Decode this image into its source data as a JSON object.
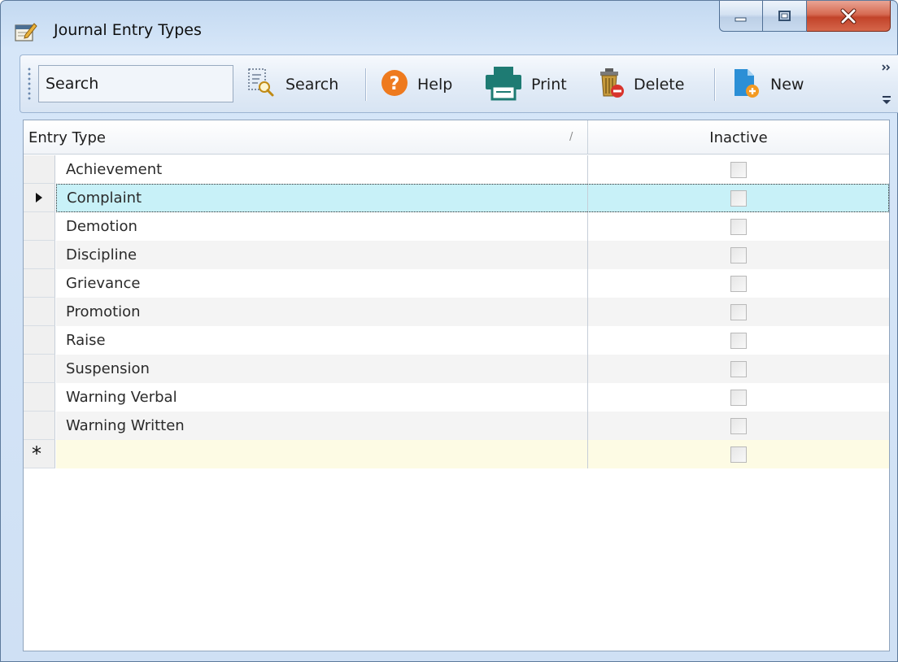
{
  "window": {
    "title": "Journal Entry Types"
  },
  "toolbar": {
    "search_placeholder": "Search",
    "search_label": "Search",
    "help_label": "Help",
    "print_label": "Print",
    "delete_label": "Delete",
    "new_label": "New"
  },
  "grid": {
    "columns": [
      "Entry Type",
      "Inactive"
    ],
    "rows": [
      {
        "entry_type": "Achievement",
        "inactive": false
      },
      {
        "entry_type": "Complaint",
        "inactive": false,
        "selected": true
      },
      {
        "entry_type": "Demotion",
        "inactive": false
      },
      {
        "entry_type": "Discipline",
        "inactive": false
      },
      {
        "entry_type": "Grievance",
        "inactive": false
      },
      {
        "entry_type": "Promotion",
        "inactive": false
      },
      {
        "entry_type": "Raise",
        "inactive": false
      },
      {
        "entry_type": "Suspension",
        "inactive": false
      },
      {
        "entry_type": "Warning Verbal",
        "inactive": false
      },
      {
        "entry_type": "Warning Written",
        "inactive": false
      }
    ],
    "new_row_glyph": "*"
  },
  "colors": {
    "selection": "#c8f1f8",
    "new_row": "#fdfbe4",
    "help_orange": "#ee7a1e",
    "print_teal": "#1e7b73",
    "new_blue": "#2b8fd6"
  },
  "icons": {
    "app": "journal-edit-icon",
    "search": "magnifier-document-icon",
    "help": "question-icon",
    "print": "printer-icon",
    "delete": "trash-can-icon",
    "new": "new-document-icon",
    "row_current": "row-pointer-icon"
  }
}
